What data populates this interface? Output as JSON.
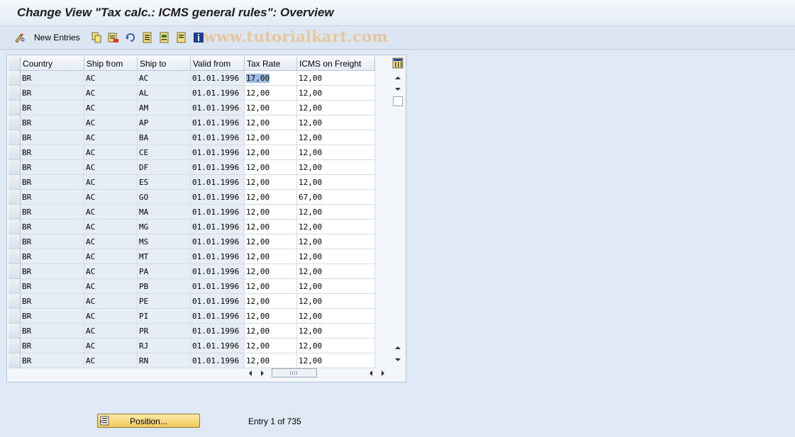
{
  "window": {
    "title": "Change View \"Tax calc.: ICMS general rules\": Overview"
  },
  "toolbar": {
    "new_entries_label": "New Entries",
    "icons": [
      "display-change-icon",
      "copy-icon",
      "delete-icon",
      "undo-icon",
      "select-all-icon",
      "select-block-icon",
      "deselect-all-icon",
      "info-icon"
    ],
    "watermark": "www.tutorialkart.com"
  },
  "table": {
    "columns": [
      "Country",
      "Ship from",
      "Ship to",
      "Valid from",
      "Tax Rate",
      "ICMS on Freight"
    ],
    "rows": [
      [
        "BR",
        "AC",
        "AC",
        "01.01.1996",
        "17,00",
        "12,00"
      ],
      [
        "BR",
        "AC",
        "AL",
        "01.01.1996",
        "12,00",
        "12,00"
      ],
      [
        "BR",
        "AC",
        "AM",
        "01.01.1996",
        "12,00",
        "12,00"
      ],
      [
        "BR",
        "AC",
        "AP",
        "01.01.1996",
        "12,00",
        "12,00"
      ],
      [
        "BR",
        "AC",
        "BA",
        "01.01.1996",
        "12,00",
        "12,00"
      ],
      [
        "BR",
        "AC",
        "CE",
        "01.01.1996",
        "12,00",
        "12,00"
      ],
      [
        "BR",
        "AC",
        "DF",
        "01.01.1996",
        "12,00",
        "12,00"
      ],
      [
        "BR",
        "AC",
        "ES",
        "01.01.1996",
        "12,00",
        "12,00"
      ],
      [
        "BR",
        "AC",
        "GO",
        "01.01.1996",
        "12,00",
        "67,00"
      ],
      [
        "BR",
        "AC",
        "MA",
        "01.01.1996",
        "12,00",
        "12,00"
      ],
      [
        "BR",
        "AC",
        "MG",
        "01.01.1996",
        "12,00",
        "12,00"
      ],
      [
        "BR",
        "AC",
        "MS",
        "01.01.1996",
        "12,00",
        "12,00"
      ],
      [
        "BR",
        "AC",
        "MT",
        "01.01.1996",
        "12,00",
        "12,00"
      ],
      [
        "BR",
        "AC",
        "PA",
        "01.01.1996",
        "12,00",
        "12,00"
      ],
      [
        "BR",
        "AC",
        "PB",
        "01.01.1996",
        "12,00",
        "12,00"
      ],
      [
        "BR",
        "AC",
        "PE",
        "01.01.1996",
        "12,00",
        "12,00"
      ],
      [
        "BR",
        "AC",
        "PI",
        "01.01.1996",
        "12,00",
        "12,00"
      ],
      [
        "BR",
        "AC",
        "PR",
        "01.01.1996",
        "12,00",
        "12,00"
      ],
      [
        "BR",
        "AC",
        "RJ",
        "01.01.1996",
        "12,00",
        "12,00"
      ],
      [
        "BR",
        "AC",
        "RN",
        "01.01.1996",
        "12,00",
        "12,00"
      ]
    ]
  },
  "footer": {
    "position_button_label": "Position...",
    "entry_text": "Entry 1 of 735"
  },
  "colors": {
    "button_yellow": "#f0c95c",
    "selection_blue": "#9fbde0",
    "readonly_cell": "#e6edf5"
  }
}
